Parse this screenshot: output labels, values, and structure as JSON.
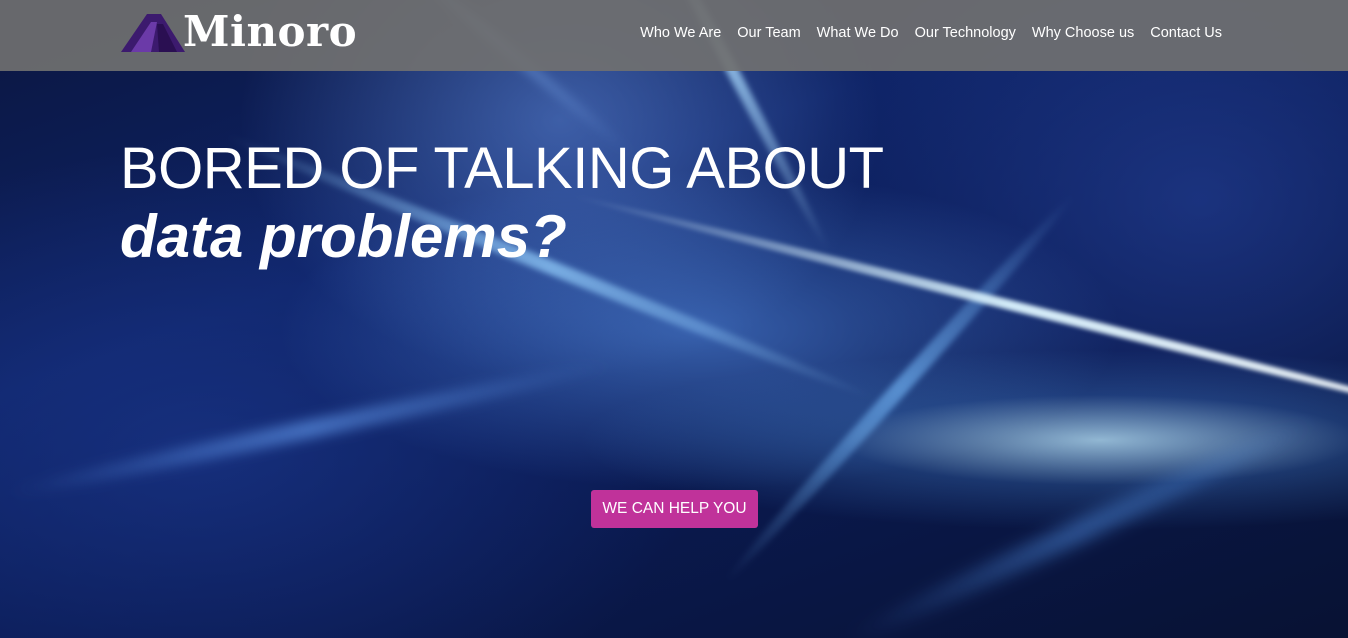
{
  "brand": {
    "name": "Minoro",
    "logo_icon": "minoro-logo-mark-icon",
    "logo_color": "#3c1a6e"
  },
  "nav": {
    "items": [
      {
        "label": "Who We Are"
      },
      {
        "label": "Our Team"
      },
      {
        "label": "What We Do"
      },
      {
        "label": "Our Technology"
      },
      {
        "label": "Why Choose us"
      },
      {
        "label": "Contact Us"
      }
    ]
  },
  "hero": {
    "headline_line1": "BORED OF TALKING ABOUT",
    "headline_line2": "data problems?",
    "cta_label": "WE CAN HELP YOU",
    "cta_color": "#c0329a"
  }
}
